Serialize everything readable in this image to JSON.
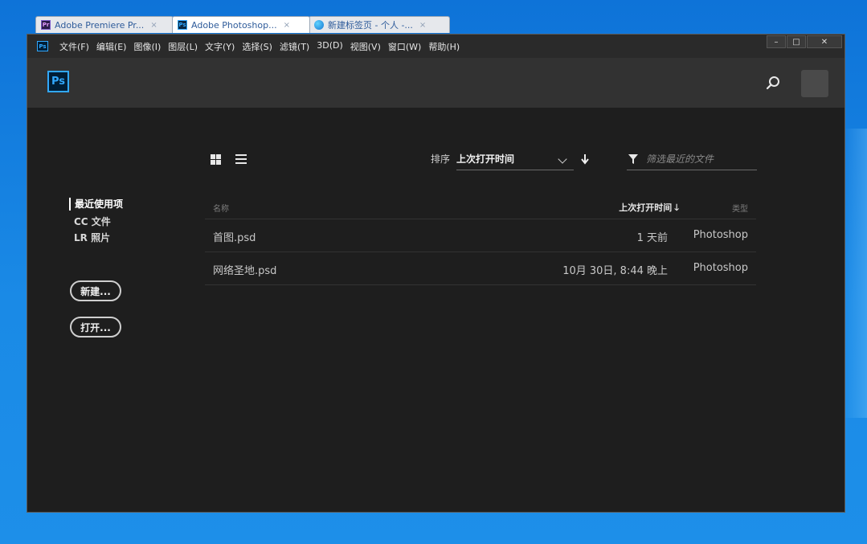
{
  "tabs": [
    {
      "label": "Adobe Premiere Pr...",
      "icon": "premiere-icon",
      "close": "×"
    },
    {
      "label": "Adobe Photoshop...",
      "icon": "photoshop-icon",
      "close": "×"
    },
    {
      "label": "新建标签页 - 个人 -...",
      "icon": "edge-icon",
      "close": "×"
    }
  ],
  "menubar": {
    "app_icon": "Ps",
    "items": [
      "文件(F)",
      "编辑(E)",
      "图像(I)",
      "图层(L)",
      "文字(Y)",
      "选择(S)",
      "滤镜(T)",
      "3D(D)",
      "视图(V)",
      "窗口(W)",
      "帮助(H)"
    ],
    "window_controls": {
      "minimize": "–",
      "maximize": "□",
      "close": "✕"
    }
  },
  "header": {
    "logo": "Ps",
    "search_icon": "search-icon",
    "avatar_icon": "avatar"
  },
  "nav": {
    "items": [
      "最近使用项",
      "CC 文件",
      "LR 照片"
    ],
    "active": "最近使用项",
    "new_button": "新建...",
    "open_button": "打开..."
  },
  "toolbar": {
    "grid_view_icon": "grid-view-icon",
    "list_view_icon": "list-view-icon",
    "sort_label": "排序",
    "sort_value": "上次打开时间",
    "sort_direction_icon": "arrow-down-icon",
    "filter_placeholder": "筛选最近的文件"
  },
  "table": {
    "headers": {
      "name": "名称",
      "opened": "上次打开时间",
      "opened_arrow": "🡓",
      "type": "类型"
    },
    "rows": [
      {
        "name": "首图.psd",
        "opened": "1 天前",
        "type": "Photoshop"
      },
      {
        "name": "网络圣地.psd",
        "opened": "10月 30日, 8:44 晚上",
        "type": "Photoshop"
      }
    ]
  },
  "colors": {
    "ps_blue": "#31a8ff",
    "app_bg": "#1e1e1e",
    "header_bg": "#323232",
    "desktop": "#1a8ae6"
  }
}
